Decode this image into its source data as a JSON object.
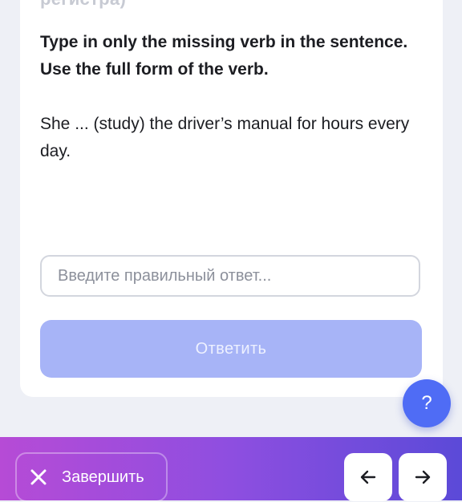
{
  "task": {
    "cut_heading": "регистра)",
    "instruction": "Type in only the missing verb in the sentence. Use the full form of the verb.",
    "question": "She ... (study) the driver’s manual for hours every day.",
    "answer_placeholder": "Введите правильный ответ...",
    "answer_value": "",
    "submit_label": "Ответить"
  },
  "help": {
    "label": "?",
    "icon": "question-icon"
  },
  "bottom_bar": {
    "finish_label": "Завершить",
    "finish_icon": "close-icon",
    "prev_icon": "arrow-left-icon",
    "next_icon": "arrow-right-icon"
  },
  "colors": {
    "accent": "#4f6cf5",
    "submit_disabled": "#a7b4f7",
    "bar_gradient_start": "#b64bd6",
    "bar_gradient_end": "#5b4ad8"
  }
}
